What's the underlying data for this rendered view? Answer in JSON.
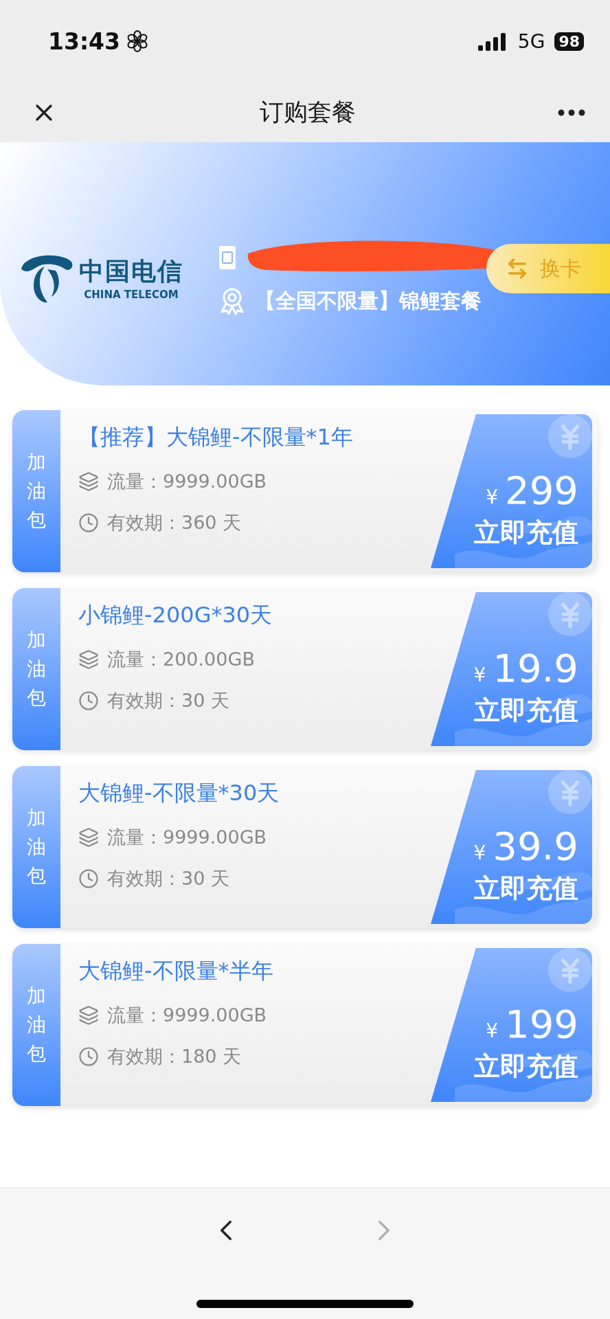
{
  "status_bar": {
    "time": "13:43",
    "network": "5G",
    "battery": "98"
  },
  "nav": {
    "title": "订购套餐"
  },
  "account": {
    "logo_cn": "中国电信",
    "logo_en": "CHINA TELECOM",
    "plan": "【全国不限量】锦鲤套餐",
    "switch_button": "换卡"
  },
  "packages": [
    {
      "tag": "加油包",
      "title": "【推荐】大锦鲤-不限量*1年",
      "data": "流量：9999.00GB",
      "validity": "有效期：360 天",
      "currency": "¥",
      "price": "299",
      "action": "立即充值"
    },
    {
      "tag": "加油包",
      "title": "小锦鲤-200G*30天",
      "data": "流量：200.00GB",
      "validity": "有效期：30 天",
      "currency": "¥",
      "price": "19.9",
      "action": "立即充值"
    },
    {
      "tag": "加油包",
      "title": "大锦鲤-不限量*30天",
      "data": "流量：9999.00GB",
      "validity": "有效期：30 天",
      "currency": "¥",
      "price": "39.9",
      "action": "立即充值"
    },
    {
      "tag": "加油包",
      "title": "大锦鲤-不限量*半年",
      "data": "流量：9999.00GB",
      "validity": "有效期：180 天",
      "currency": "¥",
      "price": "199",
      "action": "立即充值"
    }
  ],
  "toolbar": {
    "back": {
      "disabled": false
    },
    "forward": {
      "disabled": true
    }
  }
}
